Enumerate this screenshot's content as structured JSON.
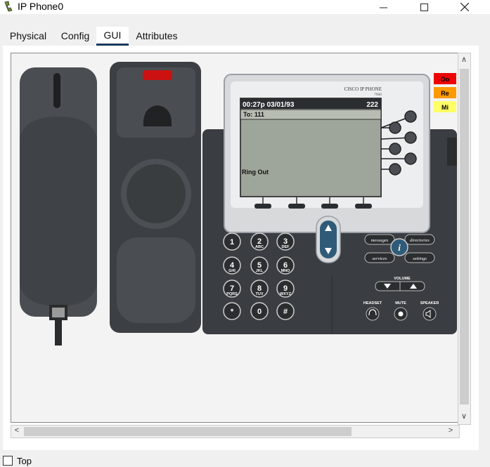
{
  "window": {
    "title": "IP Phone0",
    "minimize_icon": "minimize-icon",
    "maximize_icon": "maximize-icon",
    "close_icon": "close-icon"
  },
  "tabs": [
    {
      "label": "Physical"
    },
    {
      "label": "Config"
    },
    {
      "label": "GUI",
      "active": true
    },
    {
      "label": "Attributes"
    }
  ],
  "phone": {
    "brand": "CISCO IP PHONE",
    "model": "7960",
    "screen": {
      "time": "00:27p 03/01/93",
      "line": "222",
      "to": "To: 111",
      "status": "Ring Out"
    },
    "keys": [
      {
        "digit": "1",
        "letters": ""
      },
      {
        "digit": "2",
        "letters": "ABC"
      },
      {
        "digit": "3",
        "letters": "DEF"
      },
      {
        "digit": "4",
        "letters": "GHI"
      },
      {
        "digit": "5",
        "letters": "JKL"
      },
      {
        "digit": "6",
        "letters": "MNO"
      },
      {
        "digit": "7",
        "letters": "PQRS"
      },
      {
        "digit": "8",
        "letters": "TUV"
      },
      {
        "digit": "9",
        "letters": "WXYZ"
      },
      {
        "digit": "*",
        "letters": ""
      },
      {
        "digit": "0",
        "letters": ""
      },
      {
        "digit": "#",
        "letters": ""
      }
    ],
    "function_buttons": {
      "messages": "messages",
      "directories": "directories",
      "services": "services",
      "settings": "settings"
    },
    "volume_label": "VOLUME",
    "headset_label": "HEADSET",
    "mute_label": "MUTE",
    "speaker_label": "SPEAKER"
  },
  "indicators": [
    {
      "label": "Do",
      "color": "#ee0000"
    },
    {
      "label": "Re",
      "color": "#ff9900"
    },
    {
      "label": "Mi",
      "color": "#ffff66"
    }
  ],
  "footer": {
    "top_label": "Top"
  }
}
